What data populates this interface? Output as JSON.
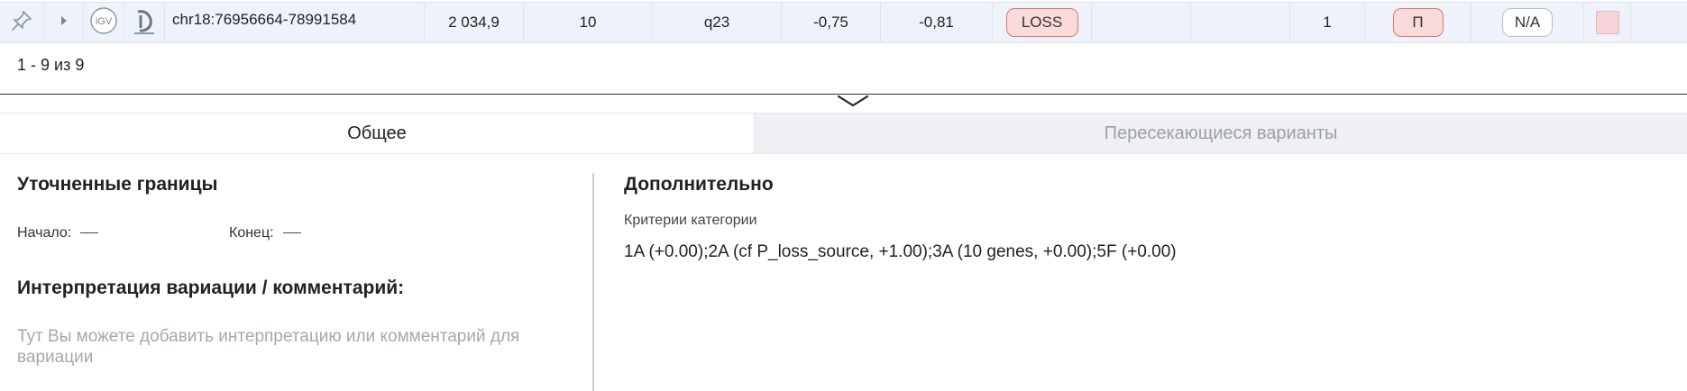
{
  "row": {
    "coordinates": "chr18:76956664-78991584",
    "size": "2 034,9",
    "genes": "10",
    "cytoband": "q23",
    "value1": "-0,75",
    "value2": "-0,81",
    "type_badge": "LOSS",
    "count": "1",
    "class_badge": "П",
    "na_badge": "N/A",
    "igv_label": "iGV",
    "colors": {
      "loss_bg": "#fbdada",
      "loss_border": "#e07373",
      "swatch": "#f6d5da"
    },
    "icons": [
      "pin-icon",
      "caret-right-icon",
      "igv-icon",
      "decipher-icon"
    ]
  },
  "pagination": {
    "text": "1 - 9 из 9"
  },
  "tabs": [
    {
      "label": "Общее",
      "active": true
    },
    {
      "label": "Пересекающиеся варианты",
      "active": false
    }
  ],
  "left_panel": {
    "refined_title": "Уточненные границы",
    "start_label": "Начало:",
    "end_label": "Конец:",
    "interpretation_title": "Интерпретация вариации / комментарий:",
    "interpretation_placeholder": "Тут Вы можете добавить интерпретацию или комментарий для вариации"
  },
  "right_panel": {
    "title": "Дополнительно",
    "criteria_label": "Критерии категории",
    "criteria_value": "1A (+0.00);2A (cf P_loss_source, +1.00);3A (10 genes, +0.00);5F (+0.00)"
  }
}
